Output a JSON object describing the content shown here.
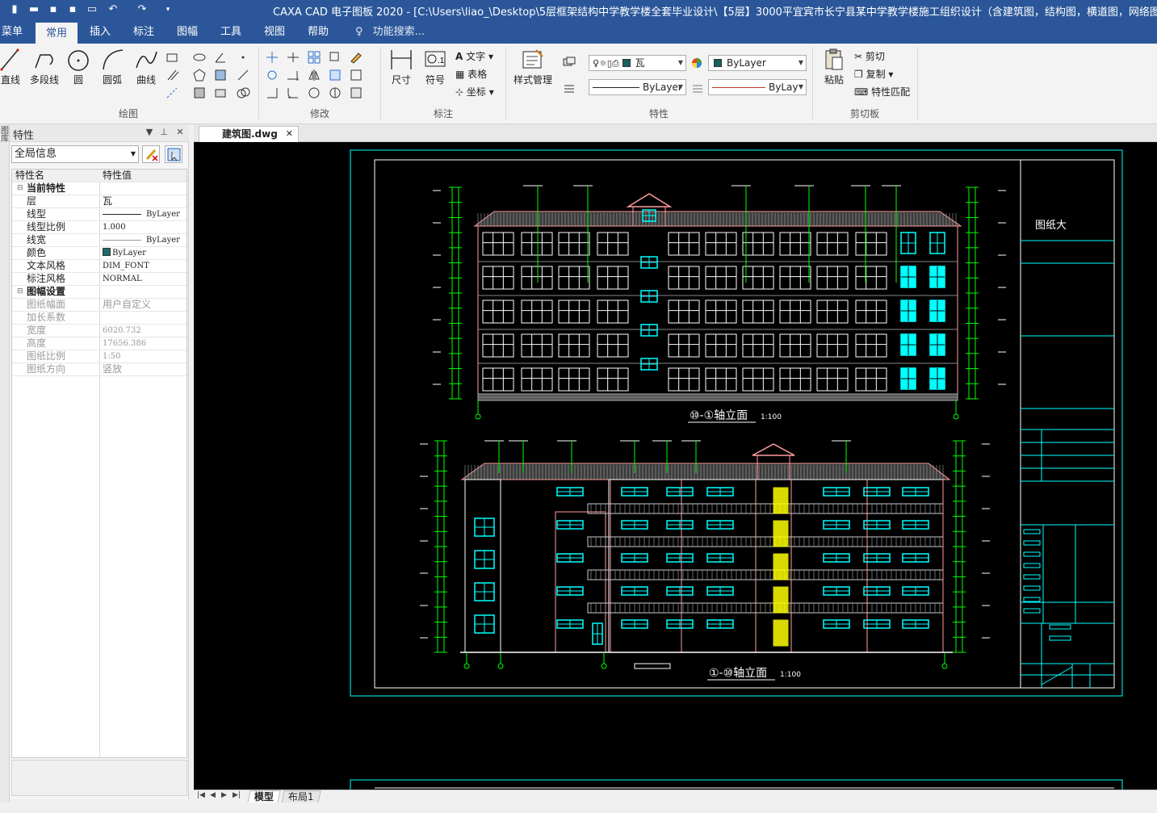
{
  "titlebar": {
    "title": "CAXA CAD 电子图板 2020 - [C:\\Users\\liao_\\Desktop\\5层框架结构中学教学楼全套毕业设计\\【5层】3000平宜宾市长宁县某中学教学楼施工组织设计（含建筑图，结构图，横道图，网络图，施工平面"
  },
  "ribbon_tabs": [
    {
      "label": "菜单"
    },
    {
      "label": "常用"
    },
    {
      "label": "插入"
    },
    {
      "label": "标注"
    },
    {
      "label": "图幅"
    },
    {
      "label": "工具"
    },
    {
      "label": "视图"
    },
    {
      "label": "帮助"
    }
  ],
  "search_tab": {
    "label": "功能搜索..."
  },
  "groups": {
    "draw": {
      "label": "绘图",
      "buttons": [
        {
          "label": "直线"
        },
        {
          "label": "多段线"
        },
        {
          "label": "圆"
        },
        {
          "label": "圆弧"
        },
        {
          "label": "曲线"
        }
      ]
    },
    "modify": {
      "label": "修改"
    },
    "annotate": {
      "label": "标注",
      "buttons": [
        {
          "label": "尺寸"
        },
        {
          "label": "符号"
        }
      ],
      "small": [
        {
          "label": "文字"
        },
        {
          "label": "表格"
        },
        {
          "label": "坐标"
        }
      ]
    },
    "properties": {
      "label": "特性",
      "style_manager": "样式管理",
      "layer_value": "瓦",
      "color_value": "ByLayer",
      "linetype_value": "ByLayer",
      "lineweight_value": "ByLay"
    },
    "clipboard": {
      "label": "剪切板",
      "paste": "粘贴",
      "small": [
        {
          "label": "剪切"
        },
        {
          "label": "复制"
        },
        {
          "label": "特性匹配"
        }
      ]
    }
  },
  "side_strip": {
    "label": "图库"
  },
  "props_panel": {
    "title": "特性",
    "scope": "全局信息",
    "col_name": "特性名",
    "col_value": "特性值",
    "rows": [
      {
        "name": "当前特性",
        "value": ""
      },
      {
        "name": "层",
        "value": "瓦"
      },
      {
        "name": "线型",
        "value": "ByLayer"
      },
      {
        "name": "线型比例",
        "value": "1.000"
      },
      {
        "name": "线宽",
        "value": "ByLayer"
      },
      {
        "name": "颜色",
        "value": "ByLayer"
      },
      {
        "name": "文本风格",
        "value": "DIM_FONT"
      },
      {
        "name": "标注风格",
        "value": "NORMAL"
      },
      {
        "name": "图幅设置",
        "value": ""
      },
      {
        "name": "图纸幅面",
        "value": "用户自定义"
      },
      {
        "name": "加长系数",
        "value": ""
      },
      {
        "name": "宽度",
        "value": "6020.732"
      },
      {
        "name": "高度",
        "value": "17656.386"
      },
      {
        "name": "图纸比例",
        "value": "1:50"
      },
      {
        "name": "图纸方向",
        "value": "竖放"
      }
    ]
  },
  "document": {
    "tab_label": "建筑图.dwg"
  },
  "drawing": {
    "title_upper": "⑩-①轴立面",
    "scale_upper": "1:100",
    "title_lower": "①-⑩轴立面",
    "scale_lower": "1:100",
    "titleblock_name": "图纸大"
  },
  "layout_tabs": [
    {
      "label": "模型"
    },
    {
      "label": "布局1"
    }
  ],
  "colors": {
    "accent": "#2b579a",
    "canvas": "#000000",
    "frame": "#00ffff",
    "window": "#00ffff",
    "dim": "#00ff00"
  }
}
